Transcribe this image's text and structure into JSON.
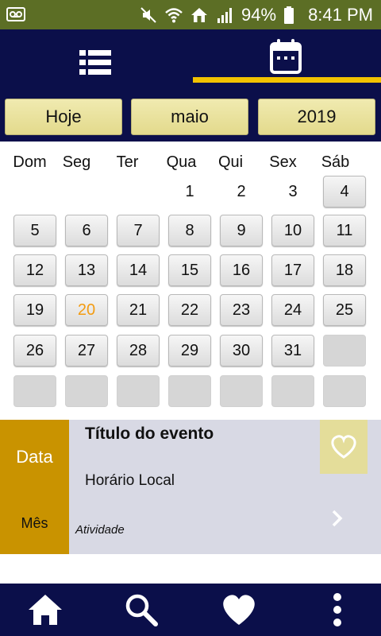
{
  "status_bar": {
    "battery": "94%",
    "time": "8:41 PM",
    "icons": [
      "voicemail-icon",
      "mute-icon",
      "wifi-icon",
      "home-data-icon",
      "signal-icon",
      "battery-icon"
    ]
  },
  "header": {
    "tabs": [
      {
        "name": "list",
        "icon": "list-icon",
        "active": false
      },
      {
        "name": "calendar",
        "icon": "calendar-icon",
        "active": true
      }
    ],
    "accent": "#f2c200",
    "background": "#0b0f4a"
  },
  "controls": {
    "today_label": "Hoje",
    "month_label": "maio",
    "year_label": "2019"
  },
  "calendar": {
    "weekdays": [
      "Dom",
      "Seg",
      "Ter",
      "Qua",
      "Qui",
      "Sex",
      "Sáb"
    ],
    "weeks": [
      [
        {
          "t": ""
        },
        {
          "t": ""
        },
        {
          "t": ""
        },
        {
          "t": "1"
        },
        {
          "t": "2"
        },
        {
          "t": "3"
        },
        {
          "t": "4",
          "btn": true
        }
      ],
      [
        {
          "t": "5",
          "btn": true
        },
        {
          "t": "6",
          "btn": true
        },
        {
          "t": "7",
          "btn": true
        },
        {
          "t": "8",
          "btn": true
        },
        {
          "t": "9",
          "btn": true
        },
        {
          "t": "10",
          "btn": true
        },
        {
          "t": "11",
          "btn": true
        }
      ],
      [
        {
          "t": "12",
          "btn": true
        },
        {
          "t": "13",
          "btn": true
        },
        {
          "t": "14",
          "btn": true
        },
        {
          "t": "15",
          "btn": true
        },
        {
          "t": "16",
          "btn": true
        },
        {
          "t": "17",
          "btn": true
        },
        {
          "t": "18",
          "btn": true
        }
      ],
      [
        {
          "t": "19",
          "btn": true
        },
        {
          "t": "20",
          "btn": true,
          "today": true
        },
        {
          "t": "21",
          "btn": true
        },
        {
          "t": "22",
          "btn": true
        },
        {
          "t": "23",
          "btn": true
        },
        {
          "t": "24",
          "btn": true
        },
        {
          "t": "25",
          "btn": true
        }
      ],
      [
        {
          "t": "26",
          "btn": true
        },
        {
          "t": "27",
          "btn": true
        },
        {
          "t": "28",
          "btn": true
        },
        {
          "t": "29",
          "btn": true
        },
        {
          "t": "30",
          "btn": true
        },
        {
          "t": "31",
          "btn": true
        },
        {
          "t": "",
          "empty": true
        }
      ],
      [
        {
          "t": "",
          "empty": true
        },
        {
          "t": "",
          "empty": true
        },
        {
          "t": "",
          "empty": true
        },
        {
          "t": "",
          "empty": true
        },
        {
          "t": "",
          "empty": true
        },
        {
          "t": "",
          "empty": true
        },
        {
          "t": "",
          "empty": true
        }
      ]
    ],
    "today_color": "#f39c12"
  },
  "event": {
    "date_label": "Data",
    "month_label": "Mês",
    "title": "Título do evento",
    "time_place": "Horário Local",
    "activity": "Atividade",
    "favorite_icon": "heart-outline-icon",
    "more_icon": "chevron-right-icon",
    "date_color": "#c99300"
  },
  "bottom_nav": {
    "items": [
      "home-icon",
      "search-icon",
      "heart-icon",
      "more-vertical-icon"
    ]
  }
}
